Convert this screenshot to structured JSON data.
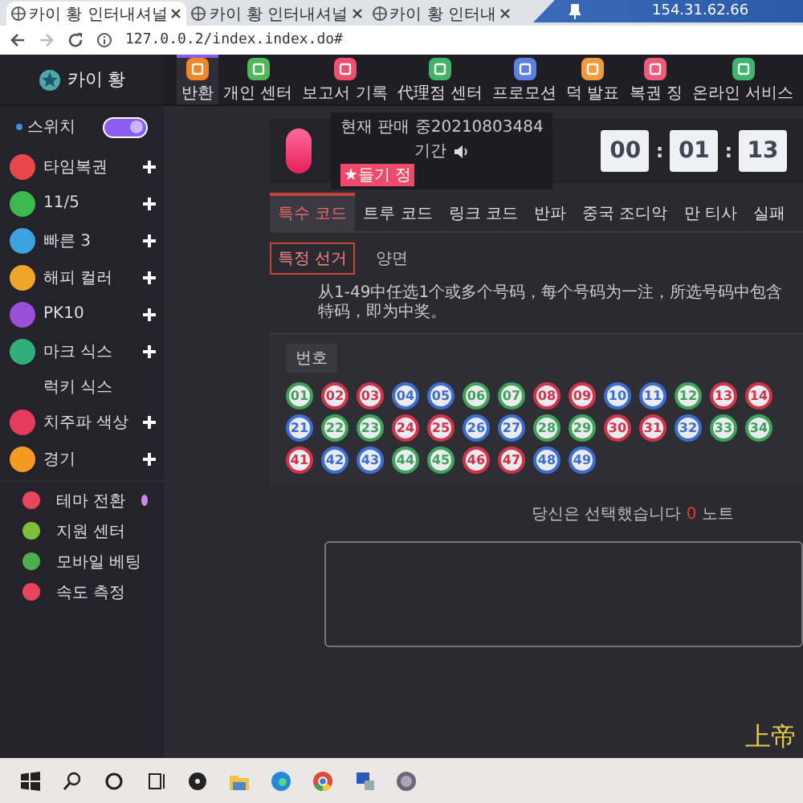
{
  "browser": {
    "tabs": [
      {
        "title": "카이 황 인터내셔널",
        "selected": true
      },
      {
        "title": "카이 황 인터내셔널",
        "selected": false
      },
      {
        "title": "카이 황 인터내",
        "selected": false
      }
    ],
    "remote_ip": "154.31.62.66",
    "url": "127.0.0.2/index.index.do#"
  },
  "brand": {
    "name": "카이 황"
  },
  "nav": [
    {
      "label": "반환",
      "color": "#f0852a",
      "selected": true
    },
    {
      "label": "개인 센터",
      "color": "#4fb85a",
      "selected": false
    },
    {
      "label": "보고서 기록",
      "color": "#ee4f6e",
      "selected": false
    },
    {
      "label": "代理점 센터",
      "color": "#43b36a",
      "selected": false
    },
    {
      "label": "프로모션",
      "color": "#5d7fe8",
      "selected": false
    },
    {
      "label": "덕 발표",
      "color": "#f39a3a",
      "selected": false
    },
    {
      "label": "복권 징",
      "color": "#f05a78",
      "selected": false
    },
    {
      "label": "온라인 서비스",
      "color": "#3fb46a",
      "selected": false
    }
  ],
  "sidebar": {
    "switch": {
      "label": "스위치",
      "on": true
    },
    "games": [
      {
        "kind": "game",
        "label": "타임복권",
        "color": "#e8464a"
      },
      {
        "kind": "game",
        "label": "11/5",
        "color": "#3cb84e"
      },
      {
        "kind": "game",
        "label": "빠른 3",
        "color": "#3aa3e0"
      },
      {
        "kind": "game",
        "label": "해피 컬러",
        "color": "#f0a52a"
      },
      {
        "kind": "game",
        "label": "PK10",
        "color": "#9a4fd8"
      },
      {
        "kind": "game",
        "label": "마크 식스",
        "color": "#2fb07a"
      },
      {
        "kind": "sub",
        "label": "럭키 식스"
      },
      {
        "kind": "game",
        "label": "치주파 색상",
        "color": "#e83a5a"
      },
      {
        "kind": "game",
        "label": "경기",
        "color": "#f29a22"
      }
    ],
    "tools": [
      {
        "label": "테마 전환",
        "color": "#e8465e",
        "dot": true
      },
      {
        "label": "지원 센터",
        "color": "#7cc03a",
        "dot": false
      },
      {
        "label": "모바일 베팅",
        "color": "#4cae4c",
        "dot": false
      },
      {
        "label": "속도 측정",
        "color": "#e8465e",
        "dot": false
      }
    ]
  },
  "draw": {
    "status": "현재 판매 중20210803484",
    "period_label": "기간",
    "badge": "★들기 정",
    "timer": [
      {
        "kind": "digits",
        "text": "00"
      },
      {
        "kind": "separator",
        "text": ":"
      },
      {
        "kind": "digits",
        "text": "01"
      },
      {
        "kind": "separator",
        "text": ":"
      },
      {
        "kind": "digits",
        "text": "13"
      }
    ]
  },
  "play_tabs": [
    {
      "label": "특수 코드",
      "selected": true
    },
    {
      "label": "트루 코드",
      "selected": false
    },
    {
      "label": "링크 코드",
      "selected": false
    },
    {
      "label": "반파",
      "selected": false
    },
    {
      "label": "중국 조디악",
      "selected": false
    },
    {
      "label": "만 티사",
      "selected": false
    },
    {
      "label": "실패",
      "selected": false
    }
  ],
  "sub_tabs": [
    {
      "label": "특정 선거",
      "selected": true
    },
    {
      "label": "양면",
      "selected": false
    }
  ],
  "rule_text": "从1-49中任选1个或多个号码，每个号码为一注，所选号码中包含特码，即为中奖。",
  "numbers_label": "번호",
  "ball_rows": [
    [
      {
        "number": "01",
        "color": "#3ea35a"
      },
      {
        "number": "02",
        "color": "#d0344a"
      },
      {
        "number": "03",
        "color": "#d0344a"
      },
      {
        "number": "04",
        "color": "#3b6ed0"
      },
      {
        "number": "05",
        "color": "#3b6ed0"
      },
      {
        "number": "06",
        "color": "#3ea35a"
      },
      {
        "number": "07",
        "color": "#3ea35a"
      },
      {
        "number": "08",
        "color": "#d0344a"
      },
      {
        "number": "09",
        "color": "#d0344a"
      },
      {
        "number": "10",
        "color": "#3b6ed0"
      },
      {
        "number": "11",
        "color": "#3b6ed0"
      },
      {
        "number": "12",
        "color": "#3ea35a"
      },
      {
        "number": "13",
        "color": "#d0344a"
      },
      {
        "number": "14",
        "color": "#d0344a"
      }
    ],
    [
      {
        "number": "21",
        "color": "#3b6ed0"
      },
      {
        "number": "22",
        "color": "#3ea35a"
      },
      {
        "number": "23",
        "color": "#3ea35a"
      },
      {
        "number": "24",
        "color": "#d0344a"
      },
      {
        "number": "25",
        "color": "#d0344a"
      },
      {
        "number": "26",
        "color": "#3b6ed0"
      },
      {
        "number": "27",
        "color": "#3b6ed0"
      },
      {
        "number": "28",
        "color": "#3ea35a"
      },
      {
        "number": "29",
        "color": "#3ea35a"
      },
      {
        "number": "30",
        "color": "#d0344a"
      },
      {
        "number": "31",
        "color": "#d0344a"
      },
      {
        "number": "32",
        "color": "#3b6ed0"
      },
      {
        "number": "33",
        "color": "#3ea35a"
      },
      {
        "number": "34",
        "color": "#3ea35a"
      }
    ],
    [
      {
        "number": "41",
        "color": "#d0344a"
      },
      {
        "number": "42",
        "color": "#3b6ed0"
      },
      {
        "number": "43",
        "color": "#3b6ed0"
      },
      {
        "number": "44",
        "color": "#3ea35a"
      },
      {
        "number": "45",
        "color": "#3ea35a"
      },
      {
        "number": "46",
        "color": "#d0344a"
      },
      {
        "number": "47",
        "color": "#d0344a"
      },
      {
        "number": "48",
        "color": "#3b6ed0"
      },
      {
        "number": "49",
        "color": "#3b6ed0"
      }
    ]
  ],
  "selection": {
    "prefix": "당신은 선택했습니다",
    "count": "0",
    "suffix": "노트"
  },
  "corner_text": "上帝"
}
